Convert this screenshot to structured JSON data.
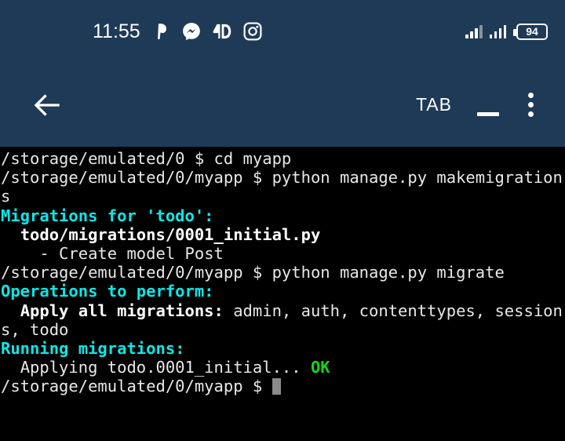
{
  "status_bar": {
    "clock": "11:55",
    "icons": [
      {
        "name": "pinterest-icon",
        "glyph": "P"
      },
      {
        "name": "messenger-icon",
        "glyph": "messenger"
      },
      {
        "name": "4d-app-icon",
        "glyph": "4D"
      },
      {
        "name": "instagram-icon",
        "glyph": "instagram"
      }
    ],
    "signal_1": "signal-bars-icon",
    "signal_2": "signal-bars-icon",
    "battery_level": "94",
    "battery_icon": "battery-icon"
  },
  "toolbar": {
    "back_icon": "back-arrow-icon",
    "tab_label": "TAB",
    "underscore_label": "_",
    "menu_icon": "overflow-menu-icon"
  },
  "terminal": {
    "lines": [
      {
        "id": "line-1",
        "segments": [
          {
            "text": "/storage/emulated/0 $ cd myapp",
            "style": "white"
          }
        ]
      },
      {
        "id": "line-2",
        "segments": [
          {
            "text": "/storage/emulated/0/myapp $ python manage.py makemigrations",
            "style": "white"
          }
        ]
      },
      {
        "id": "line-3",
        "segments": [
          {
            "text": "Migrations for 'todo':",
            "style": "cyan"
          }
        ]
      },
      {
        "id": "line-4",
        "segments": [
          {
            "text": "  todo/migrations/0001_initial.py",
            "style": "bold"
          }
        ]
      },
      {
        "id": "line-5",
        "segments": [
          {
            "text": "    - Create model Post",
            "style": "white"
          }
        ]
      },
      {
        "id": "line-6",
        "segments": [
          {
            "text": "/storage/emulated/0/myapp $ python manage.py migrate",
            "style": "white"
          }
        ]
      },
      {
        "id": "line-7",
        "segments": [
          {
            "text": "Operations to perform:",
            "style": "cyan"
          }
        ]
      },
      {
        "id": "line-8",
        "segments": [
          {
            "text": "  Apply all migrations:",
            "style": "bold"
          },
          {
            "text": " admin, auth, contenttypes, sessions, todo",
            "style": "white"
          }
        ]
      },
      {
        "id": "line-9",
        "segments": [
          {
            "text": "Running migrations:",
            "style": "cyan"
          }
        ]
      },
      {
        "id": "line-10",
        "segments": [
          {
            "text": "  Applying todo.0001_initial... ",
            "style": "white"
          },
          {
            "text": "OK",
            "style": "green"
          }
        ]
      },
      {
        "id": "line-11",
        "segments": [
          {
            "text": "/storage/emulated/0/myapp $ ",
            "style": "white"
          },
          {
            "text": "",
            "style": "cursor"
          }
        ]
      }
    ]
  },
  "colors": {
    "chrome_bg": "#1e3a57",
    "terminal_bg": "#000000",
    "terminal_fg": "#e8e8e8",
    "accent_cyan": "#0ae8e8",
    "accent_green": "#14d614",
    "cursor": "#8a8a8a"
  }
}
